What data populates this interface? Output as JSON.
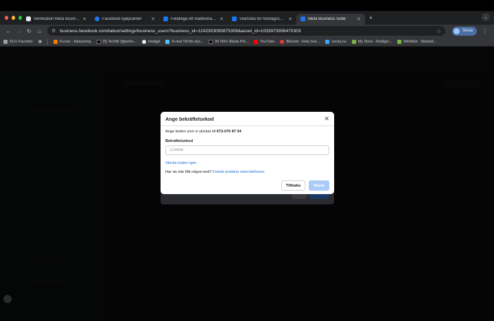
{
  "browser": {
    "tabs": [
      {
        "title": "Verifikation Meta Business Su",
        "favicon_color": "#e8eaed",
        "active": false
      },
      {
        "title": "Facebook hjälpcenter",
        "favicon_color": "#1877f2",
        "active": false
      },
      {
        "title": "Felaktiga ett inaktiverat eller lå",
        "favicon_color": "#1877f2",
        "active": false
      },
      {
        "title": "Startsida för företagssupport",
        "favicon_color": "#1877f2",
        "active": false
      },
      {
        "title": "Meta Business Suite",
        "favicon_color": "#1877f2",
        "active": true
      }
    ],
    "new_tab": "+",
    "url": "business.facebook.com/latest/settings/business_users?business_id=1242303090875308&asset_id=1033973936470303",
    "profile_label": "Skola",
    "bookmarks": [
      {
        "label": "DLG Favoriter",
        "color": "#9aa0a6"
      },
      {
        "label": "Kurser - Itslearning",
        "color": "#f57c00"
      },
      {
        "label": "(3) TechM (@petor...",
        "color": "#000000"
      },
      {
        "label": "chatgpt",
        "color": "#e8eaed"
      },
      {
        "label": "A viral TikTok-styl...",
        "color": "#4fc3f7"
      },
      {
        "label": "90 000+ Bästa Pet...",
        "color": "#000000"
      },
      {
        "label": "YouTube",
        "color": "#ff0000"
      },
      {
        "label": "Blocket - Hela Sve...",
        "color": "#e53935"
      },
      {
        "label": "vecka.nu",
        "color": "#42a5f5"
      },
      {
        "label": "My Store - Rediger...",
        "color": "#7cb342"
      },
      {
        "label": "MixMate - Startsid...",
        "color": "#7cb342"
      }
    ]
  },
  "dialog": {
    "title": "Ange bekräftelsekod",
    "close_symbol": "✕",
    "description_prefix": "Ange koden som vi skickat till ",
    "phone": "073-076 87 04",
    "code_label": "Bekräftelsekod",
    "code_placeholder": "123456",
    "code_value": "",
    "resend_link": "Skicka koden igen",
    "help_prefix": "Har du inte fått någon kod? ",
    "help_link": "Felsök problem med telefonen.",
    "back_button": "Tillbaka",
    "next_button": "Nästa"
  },
  "colors": {
    "accent": "#216fdb",
    "next_disabled": "#a9cbf5",
    "scrim": "#000000"
  }
}
